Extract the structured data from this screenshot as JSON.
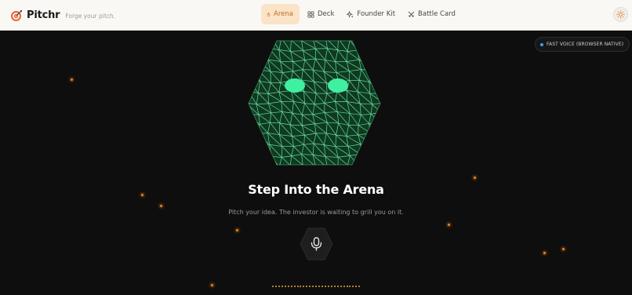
{
  "app": {
    "name": "Pitchr",
    "tagline": "Forge your pitch.",
    "logo_icon": "target-icon"
  },
  "nav": {
    "tabs": [
      {
        "label": "Arena",
        "icon": "flame-icon",
        "active": true
      },
      {
        "label": "Deck",
        "icon": "grid-icon",
        "active": false
      },
      {
        "label": "Founder Kit",
        "icon": "sparkle-icon",
        "active": false
      },
      {
        "label": "Battle Card",
        "icon": "crossed-swords-icon",
        "active": false
      }
    ]
  },
  "theme_toggle": {
    "icon": "sun-icon"
  },
  "status": {
    "voice_mode": "FAST VOICE (BROWSER NATIVE)",
    "indicator_color": "#3aa0ff"
  },
  "arena": {
    "avatar": "wireframe-hexagon-investor-face",
    "title": "Step Into the Arena",
    "subtitle": "Pitch your idea. The investor is waiting to grill you on it.",
    "mic_icon": "microphone-icon",
    "waveform_color": "#e8a33a"
  },
  "colors": {
    "accent": "#c56a1e",
    "accent_bg": "#fbe3c8",
    "avatar_eyes": "#3ff0a0",
    "avatar_mesh": "#7cf5b4",
    "background": "#0e0e0e",
    "ember": "#f0801f"
  }
}
